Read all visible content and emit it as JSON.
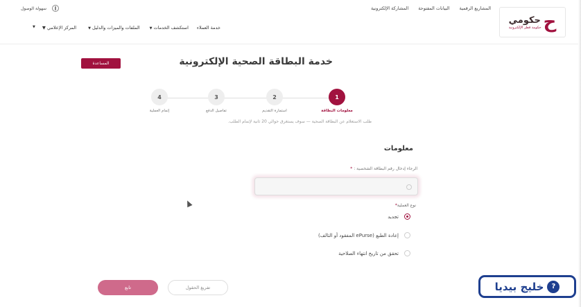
{
  "header": {
    "logo_name": "حكومي",
    "logo_sub": "حكومة قطر الإلكترونية",
    "utility_links": [
      "المشاريع الرقمية",
      "البيانات المفتوحة",
      "المشاركة الإلكترونية"
    ],
    "accessibility_label": "سهولة الوصول",
    "nav_items": [
      "خدمة العملاء",
      "استكشف الخدمات",
      "الملفات والميزات والدليل",
      "المركز الإعلامي"
    ]
  },
  "page": {
    "title": "خدمة البطاقة الصحية الإلكترونية",
    "help_label": "المساعدة"
  },
  "stepper": {
    "steps": [
      {
        "number": "1",
        "label": "معلومات البطاقة",
        "active": true
      },
      {
        "number": "2",
        "label": "استمارة التقديم",
        "active": false
      },
      {
        "number": "3",
        "label": "تفاصيل الدفع",
        "active": false
      },
      {
        "number": "4",
        "label": "إتمام العملية",
        "active": false
      }
    ],
    "notice": "طلب الاستعلام عن البطاقة الصحية — سوف يستغرق حوالي 20 ثانية لإتمام الطلب."
  },
  "form": {
    "section_title": "معلومات",
    "id_label": "الرجاء إدخال رقم البطاقة الشخصية :",
    "id_value": "",
    "operation_label": "نوع العملية",
    "options": [
      {
        "label": "تجديد",
        "checked": true
      },
      {
        "label": "إعادة الطبع (ePurse المفقود أو التالف)",
        "checked": false
      },
      {
        "label": "تحقق من تاريخ انتهاء الصلاحية",
        "checked": false
      }
    ],
    "next_label": "تابع",
    "clear_label": "تفريغ الحقول"
  },
  "watermark": {
    "text": "خليج بيديا",
    "icon_glyph": "?"
  }
}
